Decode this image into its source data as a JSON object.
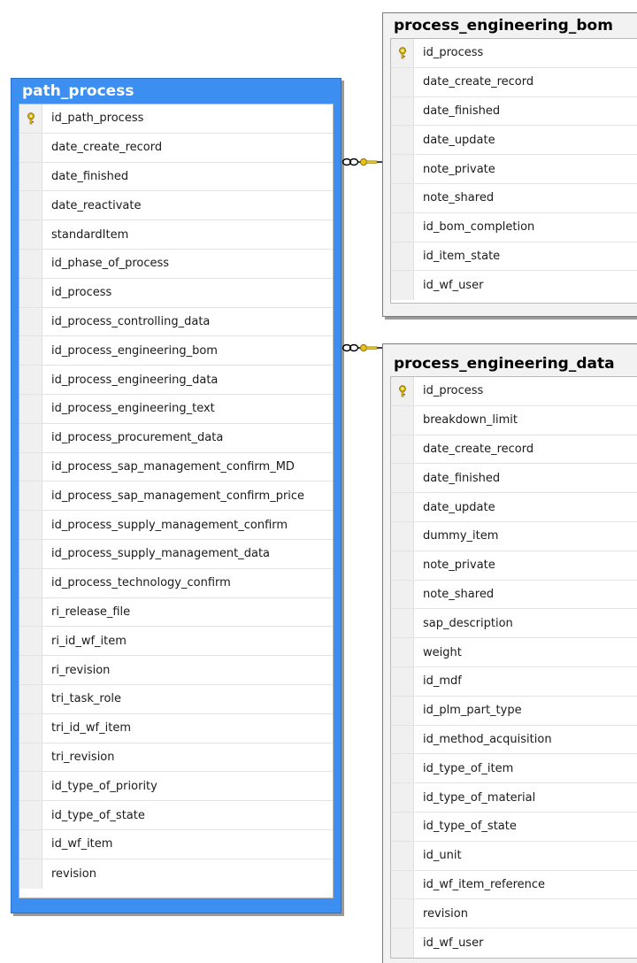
{
  "tables": {
    "path_process": {
      "title": "path_process",
      "columns": [
        {
          "name": "id_path_process",
          "primary_key": true
        },
        {
          "name": "date_create_record"
        },
        {
          "name": "date_finished"
        },
        {
          "name": "date_reactivate"
        },
        {
          "name": "standardItem"
        },
        {
          "name": "id_phase_of_process"
        },
        {
          "name": "id_process"
        },
        {
          "name": "id_process_controlling_data"
        },
        {
          "name": "id_process_engineering_bom"
        },
        {
          "name": "id_process_engineering_data"
        },
        {
          "name": "id_process_engineering_text"
        },
        {
          "name": "id_process_procurement_data"
        },
        {
          "name": "id_process_sap_management_confirm_MD"
        },
        {
          "name": "id_process_sap_management_confirm_price"
        },
        {
          "name": "id_process_supply_management_confirm"
        },
        {
          "name": "id_process_supply_management_data"
        },
        {
          "name": "id_process_technology_confirm"
        },
        {
          "name": "ri_release_file"
        },
        {
          "name": "ri_id_wf_item"
        },
        {
          "name": "ri_revision"
        },
        {
          "name": "tri_task_role"
        },
        {
          "name": "tri_id_wf_item"
        },
        {
          "name": "tri_revision"
        },
        {
          "name": "id_type_of_priority"
        },
        {
          "name": "id_type_of_state"
        },
        {
          "name": "id_wf_item"
        },
        {
          "name": "revision"
        }
      ]
    },
    "process_engineering_bom": {
      "title": "process_engineering_bom",
      "columns": [
        {
          "name": "id_process",
          "primary_key": true
        },
        {
          "name": "date_create_record"
        },
        {
          "name": "date_finished"
        },
        {
          "name": "date_update"
        },
        {
          "name": "note_private"
        },
        {
          "name": "note_shared"
        },
        {
          "name": "id_bom_completion"
        },
        {
          "name": "id_item_state"
        },
        {
          "name": "id_wf_user"
        }
      ]
    },
    "process_engineering_data": {
      "title": "process_engineering_data",
      "columns": [
        {
          "name": "id_process",
          "primary_key": true
        },
        {
          "name": "breakdown_limit"
        },
        {
          "name": "date_create_record"
        },
        {
          "name": "date_finished"
        },
        {
          "name": "date_update"
        },
        {
          "name": "dummy_item"
        },
        {
          "name": "note_private"
        },
        {
          "name": "note_shared"
        },
        {
          "name": "sap_description"
        },
        {
          "name": "weight"
        },
        {
          "name": "id_mdf"
        },
        {
          "name": "id_plm_part_type"
        },
        {
          "name": "id_method_acquisition"
        },
        {
          "name": "id_type_of_item"
        },
        {
          "name": "id_type_of_material"
        },
        {
          "name": "id_type_of_state"
        },
        {
          "name": "id_unit"
        },
        {
          "name": "id_wf_item_reference"
        },
        {
          "name": "revision"
        },
        {
          "name": "id_wf_user"
        }
      ]
    }
  },
  "relationships": [
    {
      "from": "path_process",
      "to": "process_engineering_bom",
      "from_end": "many",
      "to_end": "one"
    },
    {
      "from": "path_process",
      "to": "process_engineering_data",
      "from_end": "many",
      "to_end": "one"
    }
  ],
  "colors": {
    "selected_header": "#3c8ef0",
    "key_icon": "#e8c21a",
    "connector": "#000000"
  }
}
